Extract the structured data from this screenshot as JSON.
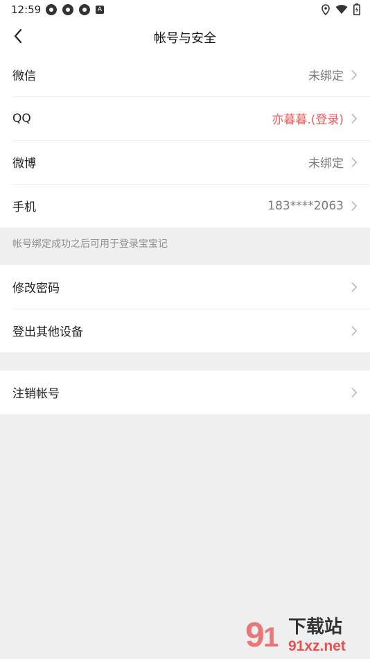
{
  "status_bar": {
    "time": "12:59",
    "left_icons": [
      "aperture-icon",
      "aperture-icon",
      "aperture-icon",
      "a-badge-icon"
    ],
    "a_badge": "A",
    "right_icons": [
      "location-icon",
      "wifi-icon",
      "battery-icon"
    ]
  },
  "header": {
    "title": "帐号与安全",
    "back_icon": "chevron-left-icon"
  },
  "bindings": [
    {
      "label": "微信",
      "value": "未绑定",
      "accent": false
    },
    {
      "label": "QQ",
      "value": "亦暮暮.(登录)",
      "accent": true
    },
    {
      "label": "微博",
      "value": "未绑定",
      "accent": false
    },
    {
      "label": "手机",
      "value": "183****2063",
      "accent": false
    }
  ],
  "hint": "帐号绑定成功之后可用于登录宝宝记",
  "security": [
    {
      "label": "修改密码"
    },
    {
      "label": "登出其他设备"
    }
  ],
  "account": [
    {
      "label": "注销帐号"
    }
  ],
  "watermark": {
    "title": "下载站",
    "url": "91xz.net"
  },
  "colors": {
    "accent": "#f25b5b",
    "background": "#efefef",
    "card": "#ffffff"
  }
}
